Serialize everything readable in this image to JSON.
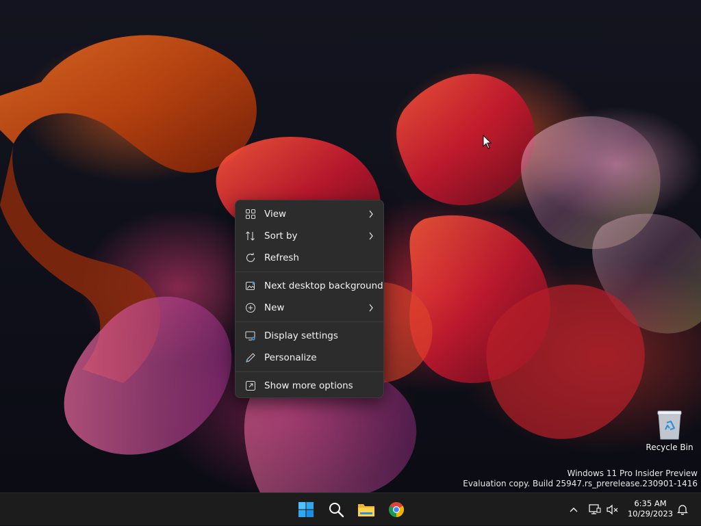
{
  "context_menu": {
    "items": [
      {
        "label": "View",
        "icon": "grid-icon",
        "has_submenu": true
      },
      {
        "label": "Sort by",
        "icon": "sort-arrows-icon",
        "has_submenu": true
      },
      {
        "label": "Refresh",
        "icon": "refresh-icon",
        "has_submenu": false
      },
      {
        "label": "Next desktop background",
        "icon": "picture-icon",
        "has_submenu": false
      },
      {
        "label": "New",
        "icon": "plus-circle-icon",
        "has_submenu": true
      },
      {
        "label": "Display settings",
        "icon": "display-settings-icon",
        "has_submenu": false
      },
      {
        "label": "Personalize",
        "icon": "pen-icon",
        "has_submenu": false
      },
      {
        "label": "Show more options",
        "icon": "expand-icon",
        "has_submenu": false
      }
    ]
  },
  "desktop": {
    "recycle_bin_label": "Recycle Bin",
    "watermark_line1": "Windows 11 Pro Insider Preview",
    "watermark_line2": "Evaluation copy. Build 25947.rs_prerelease.230901-1416"
  },
  "taskbar": {
    "pinned": [
      "start-icon",
      "search-icon",
      "file-explorer-icon",
      "chrome-icon"
    ],
    "time": "6:35 AM",
    "date": "10/29/2023"
  },
  "colors": {
    "menu_bg": "#2c2c2c",
    "taskbar_bg": "#1c1c1c",
    "accent_blue": "#3a9be8",
    "wallpaper_orange": "#d4541e",
    "wallpaper_red": "#c8202f"
  }
}
